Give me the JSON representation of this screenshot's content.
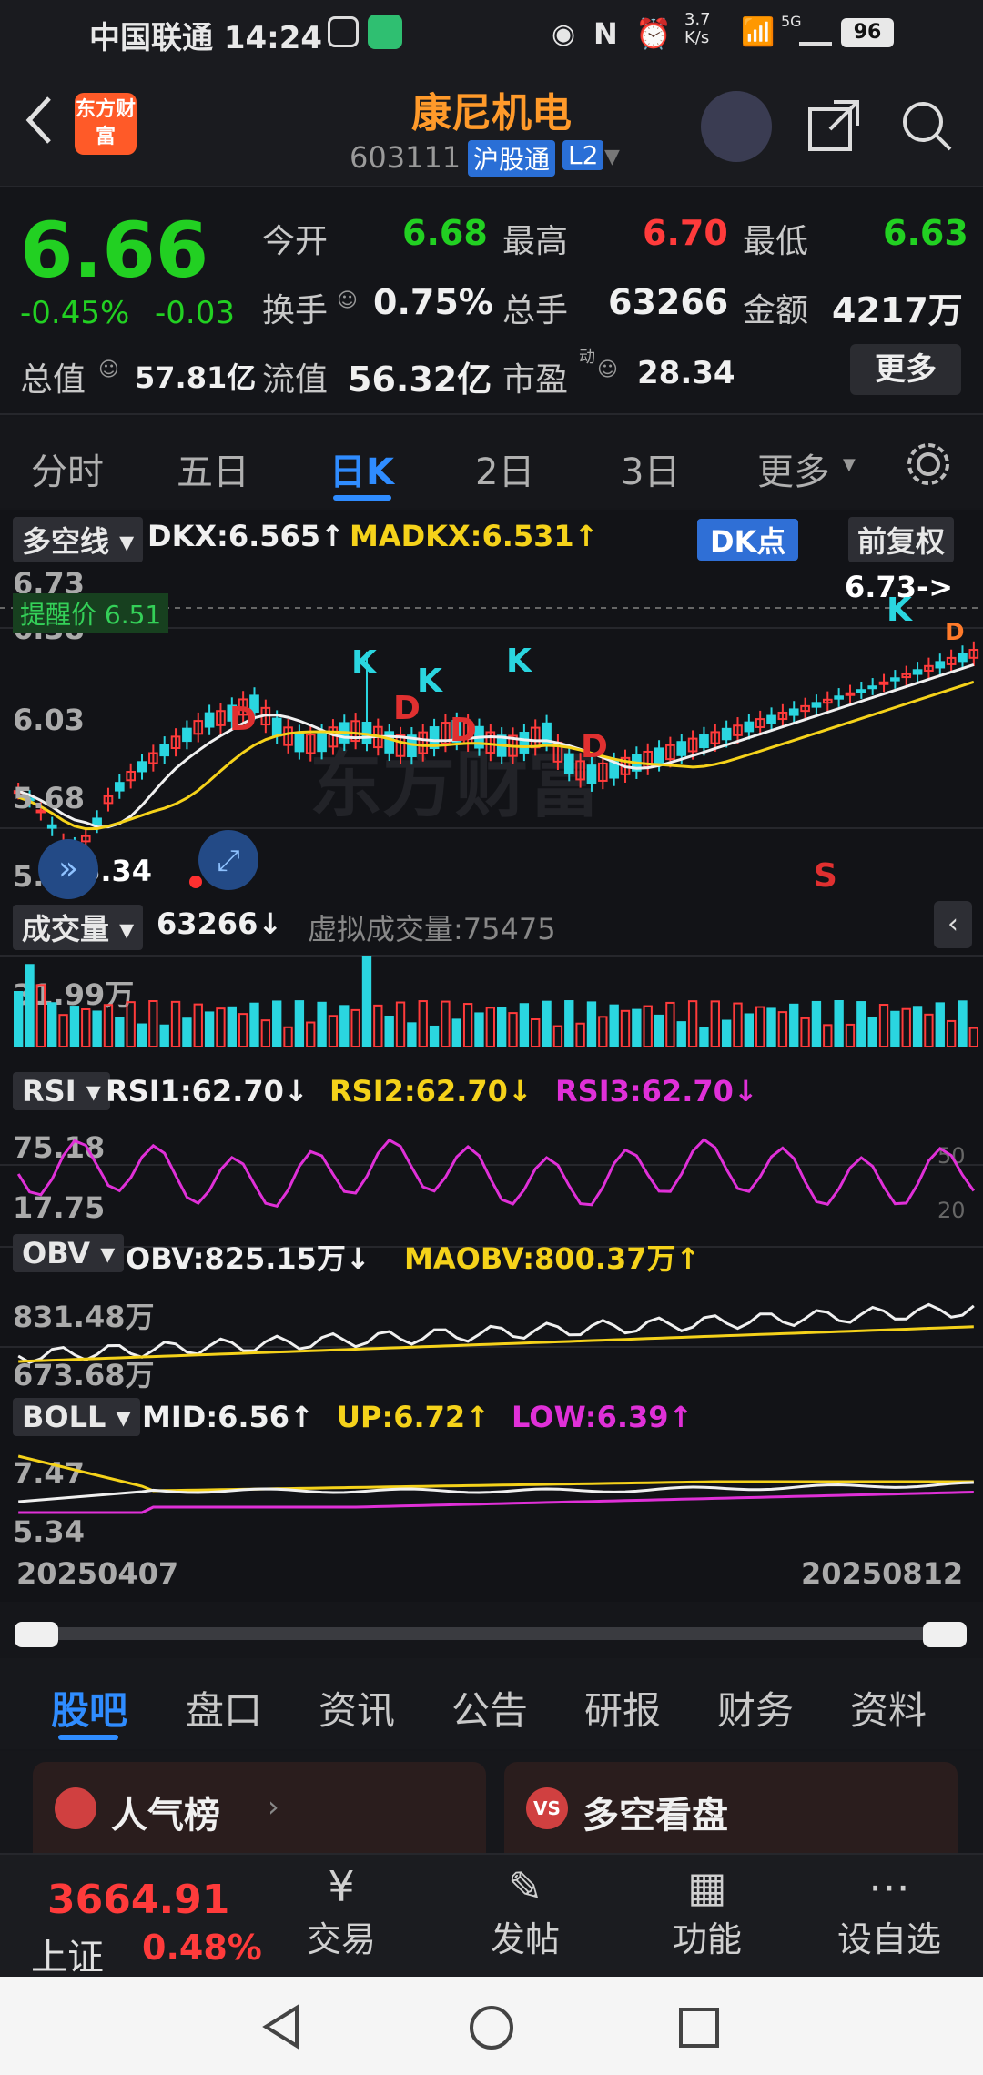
{
  "status": {
    "carrier_time": "中国联通 14:24",
    "net_speed": "3.7 K/s",
    "signal": "5G",
    "battery": "96"
  },
  "header": {
    "title": "康尼机电",
    "code": "603111",
    "market": "沪股通",
    "level": "L2",
    "logo_text": "东方财富"
  },
  "quote": {
    "price": "6.66",
    "change_pct": "-0.45%",
    "change": "-0.03",
    "open_label": "今开",
    "open": "6.68",
    "high_label": "最高",
    "high": "6.70",
    "low_label": "最低",
    "low": "6.63",
    "turnover_label": "换手",
    "turnover": "0.75%",
    "volume_label": "总手",
    "volume": "63266",
    "amount_label": "金额",
    "amount": "4217万",
    "mktcap_label": "总值",
    "mktcap": "57.81亿",
    "float_label": "流值",
    "float": "56.32亿",
    "pe_label": "市盈",
    "pe_sup": "动",
    "pe": "28.34",
    "more_label": "更多"
  },
  "tabs": [
    "分时",
    "五日",
    "日K",
    "2日",
    "3日",
    "更多"
  ],
  "chart": {
    "dkx_select": "多空线",
    "dkx": "DKX:6.565↑",
    "madkx": "MADKX:6.531↑",
    "dk_btn": "DK点",
    "fq_btn": "前复权",
    "y_labels": [
      "6.73",
      "6.38",
      "6.03",
      "5.68",
      "5.34"
    ],
    "alert": "提醒价 6.51",
    "high_mark": "6.73->",
    "low_mark": "<-5.34",
    "k_marks": [
      "K",
      "K",
      "K",
      "K"
    ],
    "d_marks": [
      "D",
      "D",
      "D",
      "D",
      "D"
    ],
    "s_mark": "S",
    "watermark": "东方财富",
    "vol_select": "成交量",
    "vol": "63266↓",
    "virtual_vol": "虚拟成交量:75475",
    "vol_max": "31.99万",
    "rsi_select": "RSI",
    "rsi1": "RSI1:62.70↓",
    "rsi2": "RSI2:62.70↓",
    "rsi3": "RSI3:62.70↓",
    "rsi_hi": "75.18",
    "rsi_lo": "17.75",
    "rsi_r1": "50",
    "rsi_r2": "20",
    "obv_select": "OBV",
    "obv": "OBV:825.15万↓",
    "maobv": "MAOBV:800.37万↑",
    "obv_hi": "831.48万",
    "obv_lo": "673.68万",
    "boll_select": "BOLL",
    "mid": "MID:6.56↑",
    "upb": "UP:6.72↑",
    "low": "LOW:6.39↑",
    "boll_hi": "7.47",
    "boll_lo": "5.34",
    "date_start": "20250407",
    "date_end": "20250812"
  },
  "bottom_tabs": [
    "股吧",
    "盘口",
    "资讯",
    "公告",
    "研报",
    "财务",
    "资料"
  ],
  "cards": {
    "left": "人气榜",
    "right": "多空看盘"
  },
  "toolbar": {
    "index_value": "3664.91",
    "index_name": "上证",
    "index_pct": "0.48%",
    "items": [
      "交易",
      "发帖",
      "功能",
      "设自选"
    ]
  },
  "colors": {
    "up": "#ff3b3b",
    "down": "#22d022",
    "accent": "#2f8cff",
    "yellow": "#f5d21a",
    "magenta": "#e030d8"
  }
}
